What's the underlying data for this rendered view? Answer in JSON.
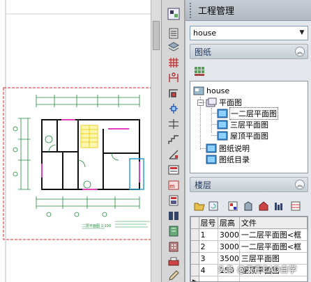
{
  "canvas": {
    "drawing_caption": "二层平面图 1:100"
  },
  "panel": {
    "title": "工程管理",
    "project_combo": {
      "value": "house"
    },
    "drawings_section": {
      "header": "图纸",
      "tree": {
        "root": "house",
        "folders": [
          {
            "label": "平面图",
            "items": [
              "一二层平面图",
              "三层平面图",
              "屋顶平面图"
            ]
          },
          {
            "label": "图纸说明"
          },
          {
            "label": "图纸目录"
          }
        ],
        "selected": "一二层平面图"
      }
    },
    "floors_section": {
      "header": "楼层",
      "columns": [
        "层号",
        "层高",
        "文件"
      ],
      "rows": [
        [
          "1",
          "3000",
          "一二层平面图<框"
        ],
        [
          "2",
          "3000",
          "一二层平面图<框"
        ],
        [
          "3",
          "3500",
          "三层平面图"
        ],
        [
          "4",
          "150",
          "屋顶平面图"
        ]
      ],
      "row_marker": "▶"
    }
  },
  "watermark": "头条 @天正CAD自学",
  "colors": {
    "panel_bg": "#e4e8ec",
    "section_header_text": "#253a5e",
    "drawing_walls": "#1f8a3b",
    "drawing_red_border": "#e02020",
    "drawing_magenta": "#e040c0"
  }
}
